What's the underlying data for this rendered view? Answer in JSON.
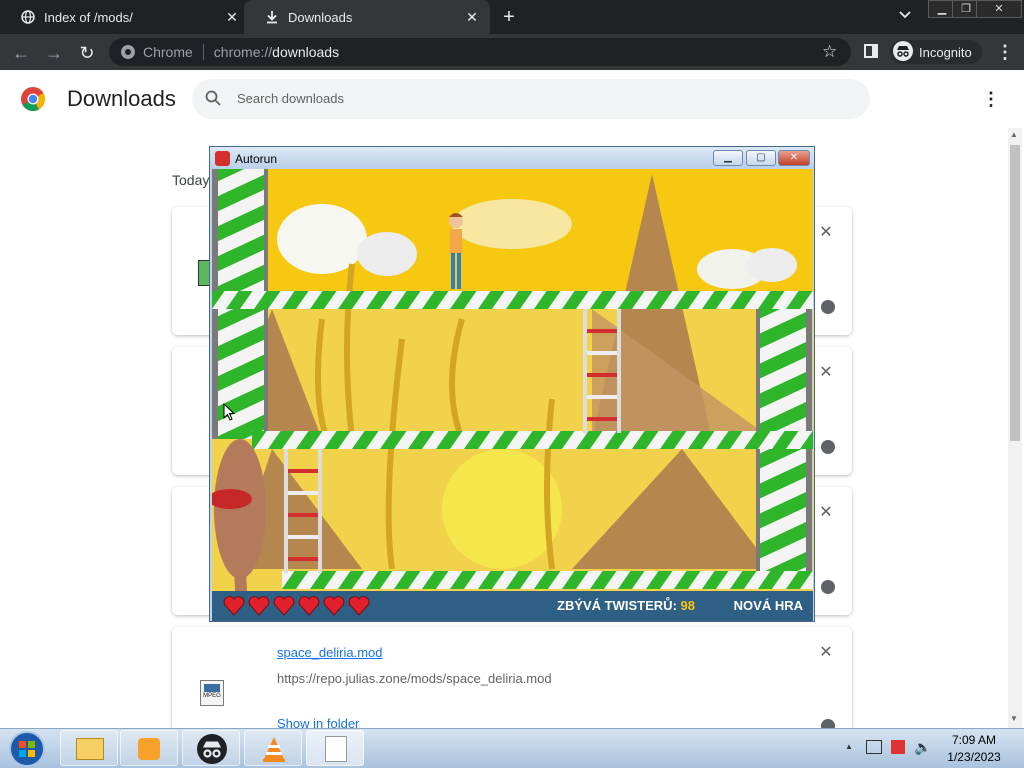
{
  "browser": {
    "tabs": [
      {
        "title": "Index of /mods/",
        "icon": "globe-icon"
      },
      {
        "title": "Downloads",
        "icon": "download-icon"
      }
    ],
    "new_tab": "+",
    "omnibox": {
      "chip": "Chrome",
      "url_prefix": "chrome://",
      "url_path": "downloads"
    },
    "profile": "Incognito"
  },
  "page": {
    "title": "Downloads",
    "search_placeholder": "Search downloads",
    "date_group": "Today"
  },
  "downloads": [
    {
      "name": "",
      "url": "",
      "action": ""
    },
    {
      "name": "",
      "url": "",
      "action": ""
    },
    {
      "name": "",
      "url": "",
      "action": ""
    },
    {
      "name": "space_deliria.mod",
      "url": "https://repo.julias.zone/mods/space_deliria.mod",
      "action": "Show in folder",
      "icon": "mpeg-file-icon",
      "icon_label": "MPEG"
    }
  ],
  "autorun": {
    "title": "Autorun",
    "hud_label": "ZBÝVÁ TWISTERŮ:",
    "hud_count": "98",
    "new_game": "NOVÁ HRA",
    "lives": 6,
    "colors": {
      "sky": "#f6c812",
      "hud": "#2e5f84",
      "stripe_green": "#2fb52a",
      "count": "#ffc60b"
    }
  },
  "taskbar": {
    "apps": [
      "explorer-icon",
      "media-player-icon",
      "incognito-icon",
      "vlc-icon",
      "autorun-icon"
    ],
    "time": "7:09 AM",
    "date": "1/23/2023"
  }
}
